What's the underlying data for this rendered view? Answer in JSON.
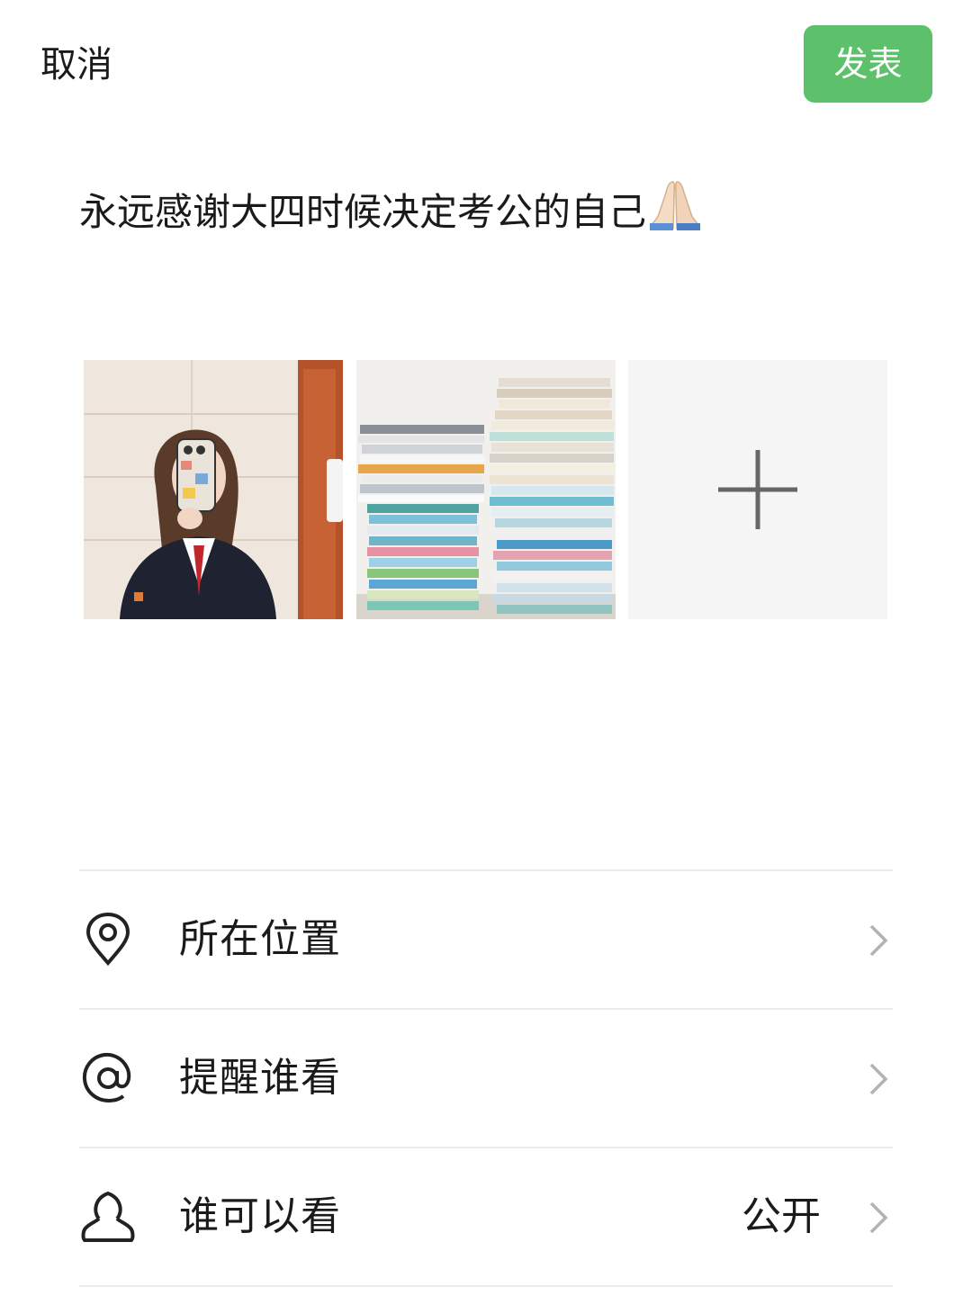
{
  "header": {
    "cancel_label": "取消",
    "publish_label": "发表"
  },
  "post": {
    "text": "永远感谢大四时候决定考公的自己"
  },
  "photos": [
    {
      "name": "mirror-selfie-photo"
    },
    {
      "name": "book-stacks-photo"
    }
  ],
  "add_photo": {
    "icon": "plus-icon"
  },
  "menu": {
    "items": [
      {
        "label": "所在位置",
        "icon": "location-pin-icon",
        "value": ""
      },
      {
        "label": "提醒谁看",
        "icon": "at-sign-icon",
        "value": ""
      },
      {
        "label": "谁可以看",
        "icon": "person-icon",
        "value": "公开"
      }
    ]
  },
  "colors": {
    "accent": "#5cc16a",
    "divider": "#ececec",
    "add_tile_bg": "#f5f5f5"
  }
}
